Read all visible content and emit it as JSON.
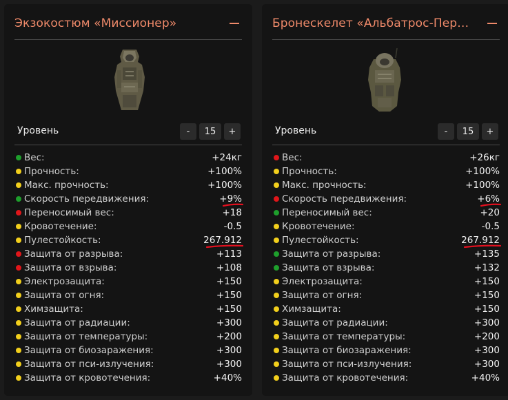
{
  "cards": [
    {
      "title": "Экзокостюм «Миссионер»",
      "level_label": "Уровень",
      "level_minus": "-",
      "level_value": "15",
      "level_plus": "+",
      "stats": [
        {
          "name": "Вес:",
          "value": "+24кг",
          "dot": "green"
        },
        {
          "name": "Прочность:",
          "value": "+100%",
          "dot": "yellow"
        },
        {
          "name": "Макс. прочность:",
          "value": "+100%",
          "dot": "yellow"
        },
        {
          "name": "Скорость передвижения:",
          "value": "+9%",
          "dot": "green",
          "underlined": true
        },
        {
          "name": "Переносимый вес:",
          "value": "+18",
          "dot": "red"
        },
        {
          "name": "Кровотечение:",
          "value": "-0.5",
          "dot": "yellow"
        },
        {
          "name": "Пулестойкость:",
          "value": "267.912",
          "dot": "yellow",
          "underlined": true
        },
        {
          "name": "Защита от разрыва:",
          "value": "+113",
          "dot": "red"
        },
        {
          "name": "Защита от взрыва:",
          "value": "+108",
          "dot": "red"
        },
        {
          "name": "Электрозащита:",
          "value": "+150",
          "dot": "yellow"
        },
        {
          "name": "Защита от огня:",
          "value": "+150",
          "dot": "yellow"
        },
        {
          "name": "Химзащита:",
          "value": "+150",
          "dot": "yellow"
        },
        {
          "name": "Защита от радиации:",
          "value": "+300",
          "dot": "yellow"
        },
        {
          "name": "Защита от температуры:",
          "value": "+200",
          "dot": "yellow"
        },
        {
          "name": "Защита от биозаражения:",
          "value": "+300",
          "dot": "yellow"
        },
        {
          "name": "Защита от пси-излучения:",
          "value": "+300",
          "dot": "yellow"
        },
        {
          "name": "Защита от кровотечения:",
          "value": "+40%",
          "dot": "yellow"
        }
      ]
    },
    {
      "title": "Бронескелет «Альбатрос-Перехватчик»",
      "level_label": "Уровень",
      "level_minus": "-",
      "level_value": "15",
      "level_plus": "+",
      "stats": [
        {
          "name": "Вес:",
          "value": "+26кг",
          "dot": "red"
        },
        {
          "name": "Прочность:",
          "value": "+100%",
          "dot": "yellow"
        },
        {
          "name": "Макс. прочность:",
          "value": "+100%",
          "dot": "yellow"
        },
        {
          "name": "Скорость передвижения:",
          "value": "+6%",
          "dot": "red",
          "underlined": true
        },
        {
          "name": "Переносимый вес:",
          "value": "+20",
          "dot": "green"
        },
        {
          "name": "Кровотечение:",
          "value": "-0.5",
          "dot": "yellow"
        },
        {
          "name": "Пулестойкость:",
          "value": "267.912",
          "dot": "yellow",
          "underlined": true
        },
        {
          "name": "Защита от разрыва:",
          "value": "+135",
          "dot": "green"
        },
        {
          "name": "Защита от взрыва:",
          "value": "+132",
          "dot": "green"
        },
        {
          "name": "Электрозащита:",
          "value": "+150",
          "dot": "yellow"
        },
        {
          "name": "Защита от огня:",
          "value": "+150",
          "dot": "yellow"
        },
        {
          "name": "Химзащита:",
          "value": "+150",
          "dot": "yellow"
        },
        {
          "name": "Защита от радиации:",
          "value": "+300",
          "dot": "yellow"
        },
        {
          "name": "Защита от температуры:",
          "value": "+200",
          "dot": "yellow"
        },
        {
          "name": "Защита от биозаражения:",
          "value": "+300",
          "dot": "yellow"
        },
        {
          "name": "Защита от пси-излучения:",
          "value": "+300",
          "dot": "yellow"
        },
        {
          "name": "Защита от кровотечения:",
          "value": "+40%",
          "dot": "yellow"
        }
      ]
    }
  ],
  "colors": {
    "title": "#ef8a6a",
    "green": "#1e9f2c",
    "yellow": "#f2cf1c",
    "red": "#e0161a",
    "underline": "#e3101f"
  },
  "icons": {
    "collapse": "minus-icon",
    "item_left": "exoskeleton-image",
    "item_right": "armor-suit-image"
  }
}
